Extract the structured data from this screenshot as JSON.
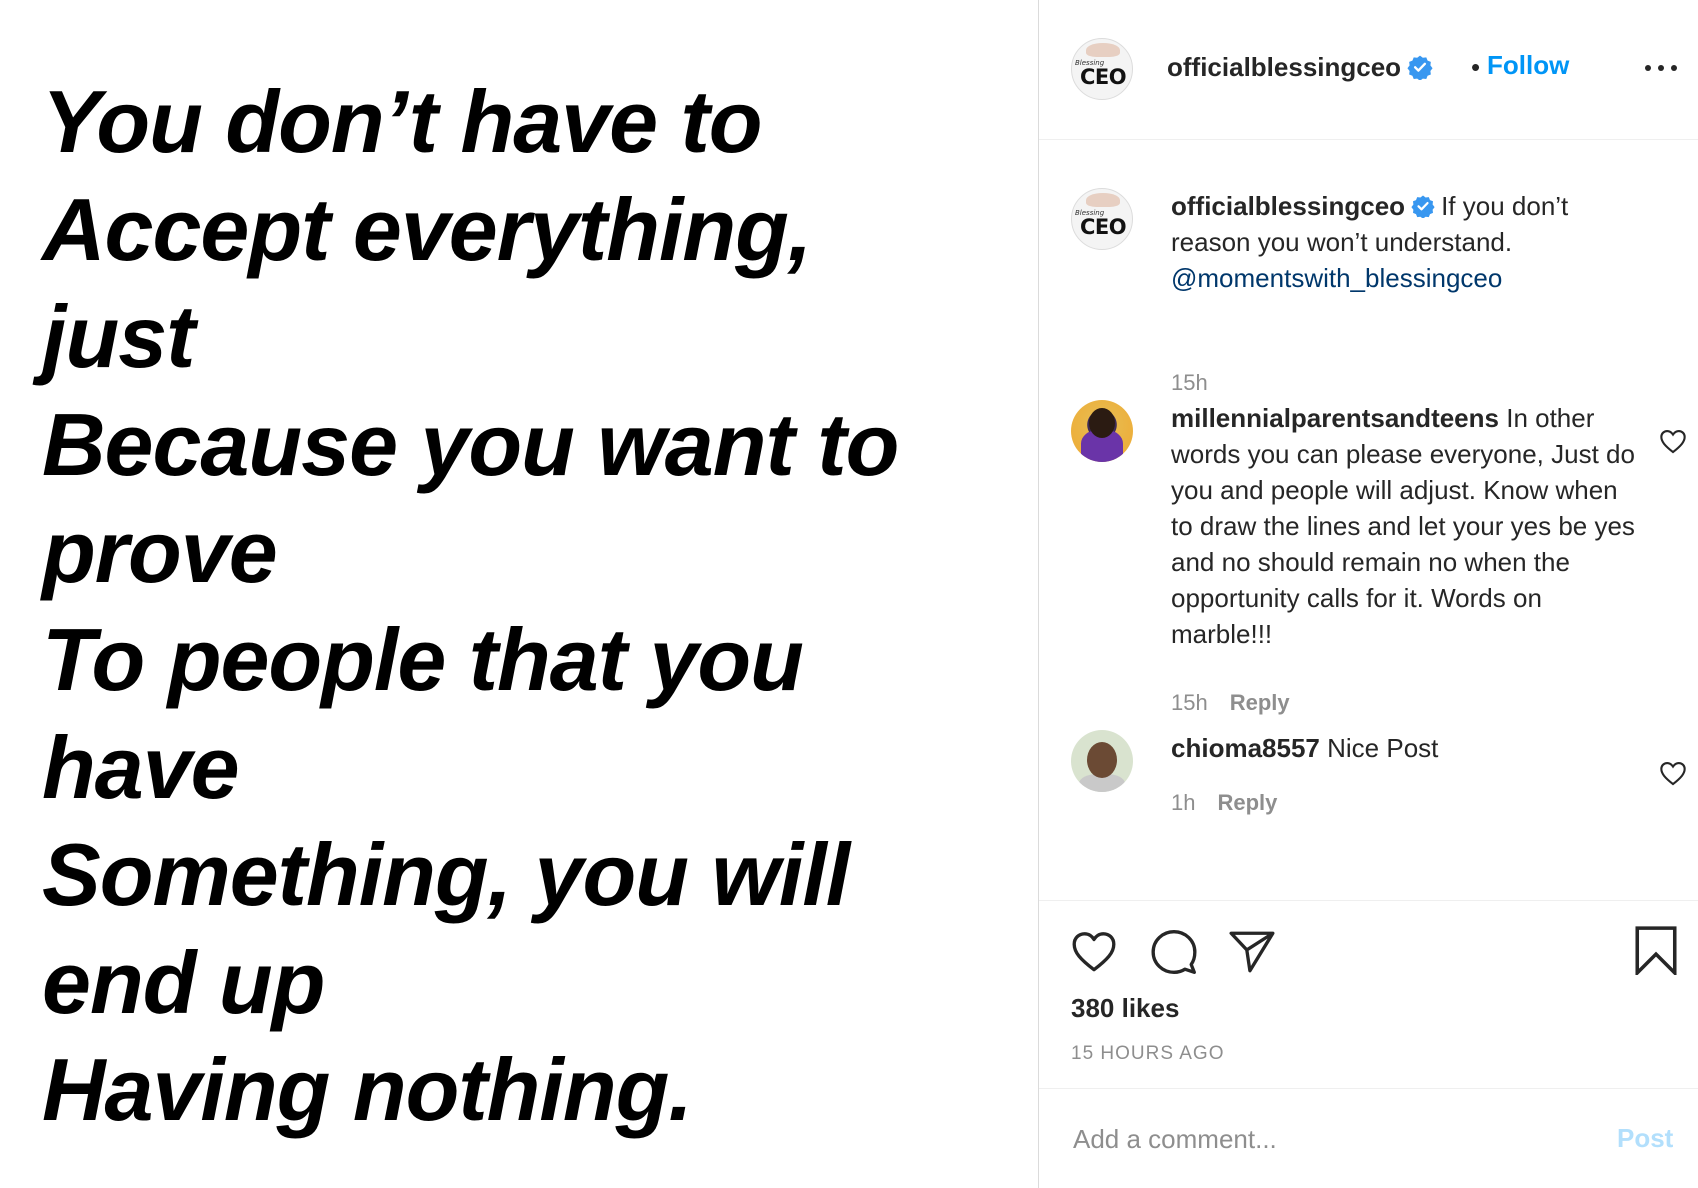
{
  "image": {
    "quote_lines": [
      "You don’t have to",
      "Accept everything,",
      "just",
      "Because you want to",
      "prove",
      "To people that you",
      "have",
      "Something, you will",
      "end up",
      "Having nothing."
    ]
  },
  "header": {
    "avatar_text_small": "Blessing",
    "avatar_text": "CEO",
    "username": "officialblessingceo",
    "separator": "•",
    "follow_label": "Follow"
  },
  "caption": {
    "username": "officialblessingceo",
    "text": "If you don’t reason you won’t understand.",
    "mention": "@momentswith_blessingceo",
    "time": "15h"
  },
  "comments": [
    {
      "username": "millennialparentsandteens",
      "text": "In other words you can please everyone, Just do you and people will adjust. Know when to draw the lines and let your yes be yes and no should remain no when the opportunity calls for it. Words on marble!!!",
      "time": "15h",
      "reply_label": "Reply"
    },
    {
      "username": "chioma8557",
      "text": "Nice Post",
      "time": "1h",
      "reply_label": "Reply"
    }
  ],
  "actions": {
    "likes": "380 likes",
    "posted": "15 HOURS AGO"
  },
  "add_comment": {
    "placeholder": "Add a comment...",
    "post_label": "Post"
  },
  "colors": {
    "link_blue": "#0095f6",
    "verified_blue": "#3897f0",
    "mention": "#00376b",
    "muted": "#8e8e8e",
    "post_disabled": "#b2dffc"
  },
  "icons": [
    "verified-badge-icon",
    "more-options-icon",
    "heart-icon",
    "comment-icon",
    "share-icon",
    "bookmark-icon"
  ]
}
